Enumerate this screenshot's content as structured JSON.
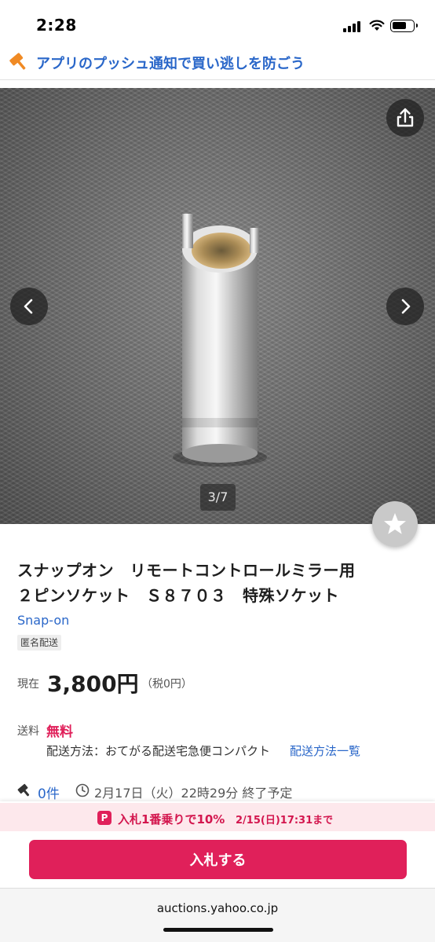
{
  "status_bar": {
    "time": "2:28"
  },
  "banner": {
    "text": "アプリのプッシュ通知で買い逃しを防ごう",
    "icon": "auction-hammer-icon"
  },
  "gallery": {
    "counter": "3/7",
    "current_image": 3,
    "total_images": 7,
    "icons": [
      "share-icon",
      "chevron-left-icon",
      "chevron-right-icon",
      "star-icon"
    ]
  },
  "product": {
    "title_line1": "スナップオン　リモートコントロールミラー用",
    "title_line2": "２ピンソケット　Ｓ８７０３　特殊ソケット",
    "brand": "Snap-on",
    "tag": "匿名配送"
  },
  "price": {
    "label": "現在",
    "value": "3,800円",
    "tax": "（税0円）"
  },
  "shipping": {
    "label": "送料",
    "value": "無料",
    "method": "配送方法：おてがる配送宅急便コンパクト",
    "link": "配送方法一覧"
  },
  "auction": {
    "bids": "0件",
    "end_time": "2月17日（火）22時29分 終了予定"
  },
  "promo": {
    "badge": "P",
    "text": "入札1番乗りで10%",
    "deadline": "2/15(日)17:31まで"
  },
  "actions": {
    "bid_button": "入札する"
  },
  "browser": {
    "url": "auctions.yahoo.co.jp"
  },
  "colors": {
    "accent": "#e0205a",
    "link": "#2a67c9",
    "promo_bg": "#fde8ec"
  }
}
